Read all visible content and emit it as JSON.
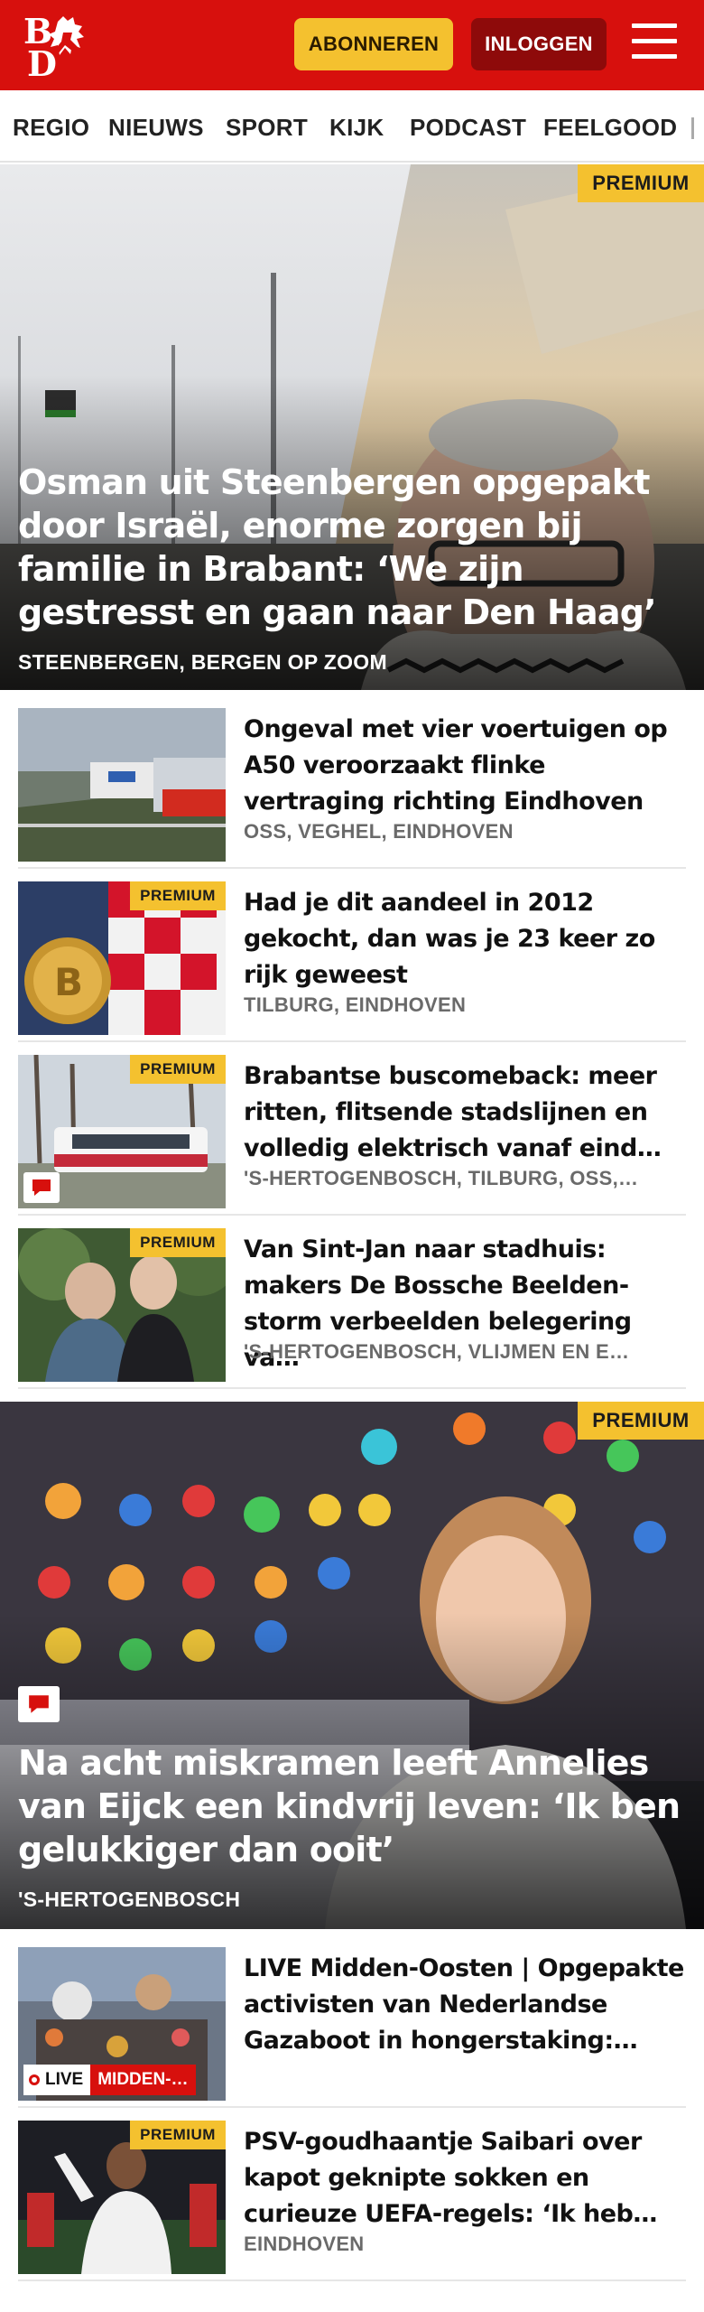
{
  "header": {
    "logo_text": "BD",
    "subscribe_label": "ABONNEREN",
    "login_label": "INLOGGEN",
    "menu_icon": "hamburger-menu-icon",
    "brand_color": "#d7100d",
    "accent_color": "#f4c12f"
  },
  "nav": {
    "items": [
      {
        "label": "REGIO"
      },
      {
        "label": "NIEUWS"
      },
      {
        "label": "SPORT"
      },
      {
        "label": "KIJK"
      },
      {
        "label": "PODCAST"
      },
      {
        "label": "FEELGOOD"
      }
    ]
  },
  "hero1": {
    "badge": "PREMIUM",
    "title": "Osman uit Steenbergen opgepakt door Israël, enorme zorgen bij familie in Brabant: ‘We zijn gestresst en gaan naar Den Haag’",
    "location": "STEENBERGEN, BERGEN OP ZOOM"
  },
  "list1": [
    {
      "title": "Ongeval met vier voertuigen op A50 veroorzaakt flinke vertraging richting Eindhoven",
      "location": "OSS, VEGHEL, EINDHOVEN",
      "premium": false
    },
    {
      "title": "Had je dit aandeel in 2012 gekocht, dan was je 23 keer zo rijk geweest",
      "location": "TILBURG, EINDHOVEN",
      "premium": true,
      "badge": "PREMIUM"
    },
    {
      "title": "Brabantse buscomeback: meer ritten, flitsende stadslijnen en volledig elektrisch vanaf eind…",
      "location": "'S-HERTOGENBOSCH, TILBURG, OSS,…",
      "premium": true,
      "badge": "PREMIUM",
      "comments_icon": "comment-icon"
    },
    {
      "title": "Van Sint-Jan naar stadhuis: makers De Bossche Beelden-storm verbeelden belegering va…",
      "location": "'S-HERTOGENBOSCH, VLIJMEN EN E…",
      "premium": true,
      "badge": "PREMIUM"
    }
  ],
  "hero2": {
    "badge": "PREMIUM",
    "title": "Na acht miskramen leeft Annelies van Eijck een kindvrij leven: ‘Ik ben gelukkiger dan ooit’",
    "location": "'S-HERTOGENBOSCH",
    "comments_icon": "comment-icon"
  },
  "list2": [
    {
      "title": "LIVE Midden-Oosten | Opgepakte activisten van Nederlandse Gazaboot in hongerstaking:…",
      "live_label": "LIVE",
      "live_category": "MIDDEN-…"
    },
    {
      "title": "PSV-goudhaantje Saibari over kapot geknipte sokken en curieuze UEFA-regels: ‘Ik heb…",
      "location": "EINDHOVEN",
      "badge": "PREMIUM"
    }
  ]
}
